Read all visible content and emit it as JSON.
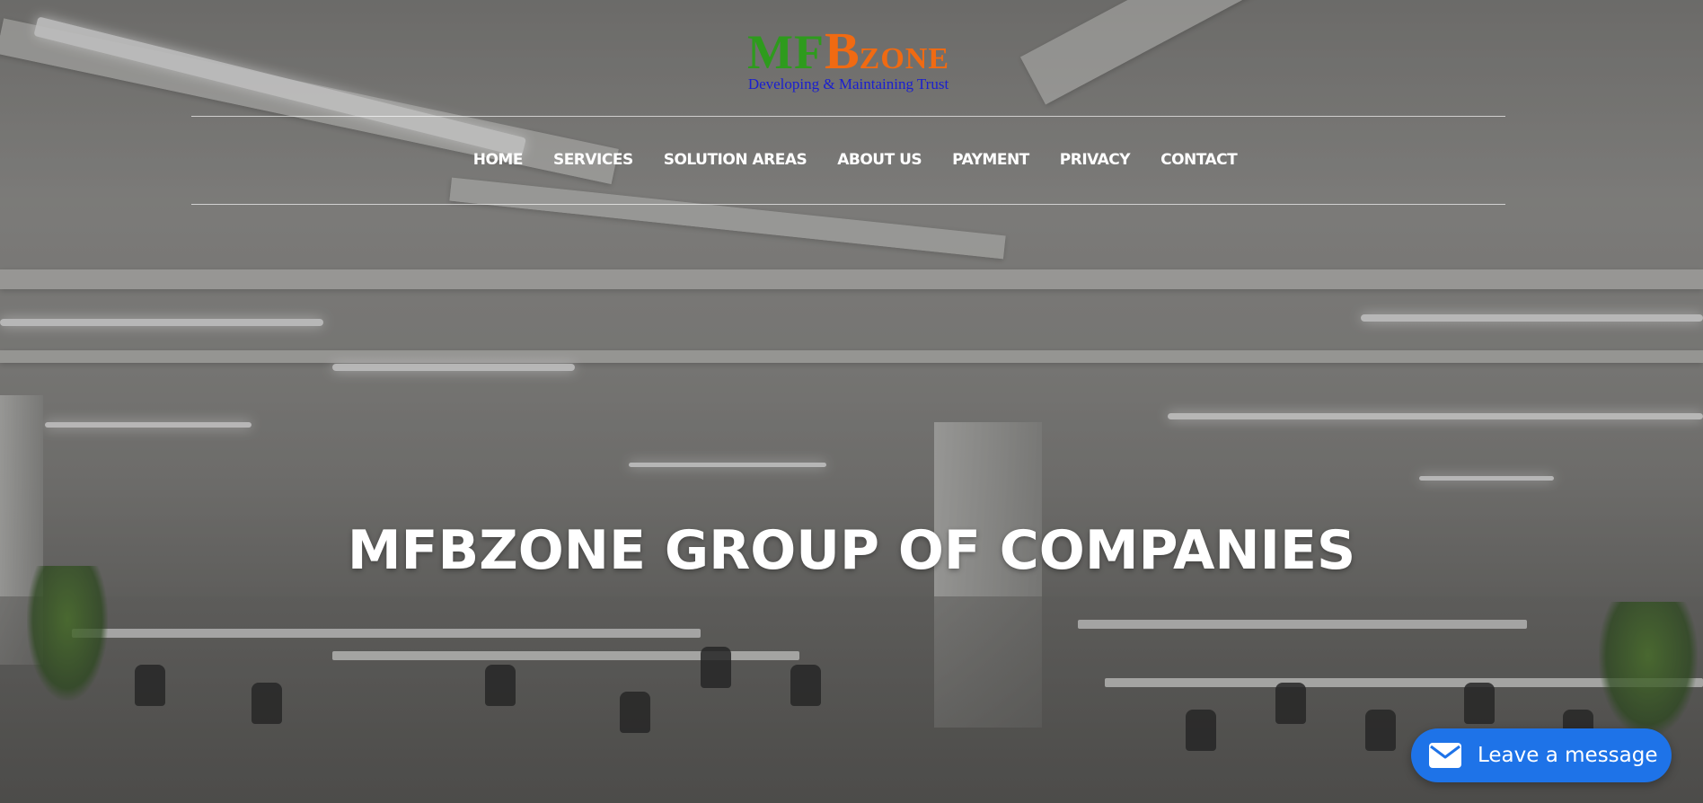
{
  "logo": {
    "mark_mf": "MF",
    "mark_b": "B",
    "mark_zone": "ZONE",
    "tagline": "Developing & Maintaining Trust",
    "colors": {
      "mf": "#2e9b1d",
      "bzone": "#f06a12",
      "tagline": "#1a1fd0"
    }
  },
  "nav": {
    "items": [
      {
        "label": "HOME"
      },
      {
        "label": "SERVICES"
      },
      {
        "label": "SOLUTION AREAS"
      },
      {
        "label": "ABOUT US"
      },
      {
        "label": "PAYMENT"
      },
      {
        "label": "PRIVACY"
      },
      {
        "label": "CONTACT"
      }
    ]
  },
  "hero": {
    "headline": "MFBZONE GROUP OF COMPANIES",
    "background": "office-interior-photo"
  },
  "chat": {
    "label": "Leave a message",
    "icon": "mail-icon",
    "color": "#1e73e8"
  }
}
